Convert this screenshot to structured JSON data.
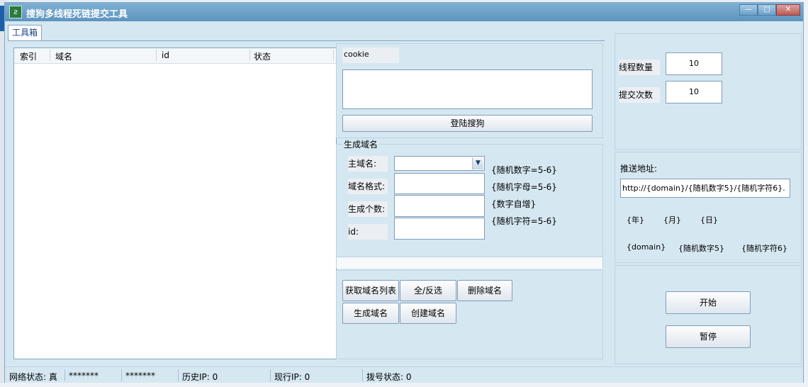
{
  "window": {
    "title": "搜狗多线程死链提交工具",
    "app_icon": "sougou-icon",
    "controls": {
      "minimize": "—",
      "maximize": "□",
      "close": "✕"
    }
  },
  "tabs": [
    {
      "label": "工具箱"
    }
  ],
  "list": {
    "columns": [
      "索引",
      "域名",
      "id",
      "状态"
    ],
    "rows": []
  },
  "cookie": {
    "label": "cookie",
    "value": ""
  },
  "login_button": "登陆搜狗",
  "generate": {
    "group_title": "生成域名",
    "main_domain_label": "主域名:",
    "main_domain_value": "",
    "format_label": "域名格式:",
    "format_value": "",
    "count_label": "生成个数:",
    "count_value": "",
    "id_label": "id:",
    "id_value": "",
    "hints": [
      "{随机数字=5-6}",
      "{随机字母=5-6}",
      "{数字自增}",
      "{随机字符=5-6}"
    ]
  },
  "actions": {
    "fetch_list": "获取域名列表",
    "toggle_select": "全/反选",
    "delete_domain": "删除域名",
    "generate_domain": "生成域名",
    "create_domain": "创建域名"
  },
  "settings": {
    "thread_label": "线程数量",
    "thread_value": "10",
    "submit_label": "提交次数",
    "submit_value": "10"
  },
  "push": {
    "label": "推送地址:",
    "url": "http://{domain}/{随机数字5}/{随机字符6}.",
    "tokens_row1": [
      "{年}",
      "{月}",
      "{日}"
    ],
    "tokens_row2": [
      "{domain}",
      "{随机数字5}",
      "{随机字符6}"
    ]
  },
  "control": {
    "start": "开始",
    "pause": "暂停"
  },
  "status_bar": {
    "network": "网络状态: 真",
    "mask1": "*******",
    "mask2": "*******",
    "history_ip": "历史IP: 0",
    "current_ip": "现行IP: 0",
    "dial_status": "拨号状态: 0"
  },
  "colors": {
    "window_bg": "#d5e7f1",
    "titlebar": "#5d94bf",
    "border": "#7fa7c4",
    "tab_text": "#1a3f8c"
  }
}
